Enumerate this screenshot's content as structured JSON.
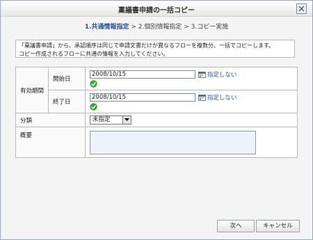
{
  "dialog": {
    "title": "稟議書申請の一括コピー",
    "steps": {
      "step1": "1.共通情報指定",
      "sep1": " > ",
      "step2": "2.個別情報指定",
      "sep2": " > ",
      "step3": "3.コピー実施"
    },
    "description": {
      "line1": "「稟議書申請」から、承認順序は同じで申請文書だけが異なるフローを複数分、一括でコピーします。",
      "line2": "コピー作成されるフローに共通の情報を入力してください。"
    }
  },
  "form": {
    "validity_label": "有効期間",
    "start_label": "開始日",
    "start_value": "2008/10/15",
    "end_label": "終了日",
    "end_value": "2008/10/15",
    "no_limit_label": "指定しない",
    "category_label": "分類",
    "category_value": "未指定",
    "summary_label": "概要",
    "summary_value": ""
  },
  "buttons": {
    "next": "次へ",
    "cancel": "キャンセル"
  },
  "colors": {
    "accent": "#2b4f9e",
    "link": "#1f5fb8",
    "check": "#3fa531"
  }
}
